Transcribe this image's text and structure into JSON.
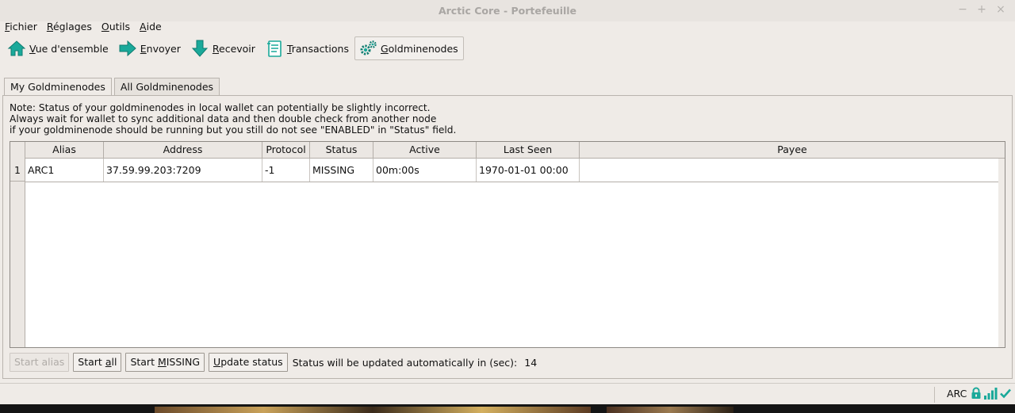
{
  "window": {
    "title": "Arctic Core - Portefeuille",
    "controls": {
      "minimize": "−",
      "maximize": "+",
      "close": "×"
    }
  },
  "menu": [
    {
      "label": "Fichier",
      "mnemonic_index": 0
    },
    {
      "label": "Réglages",
      "mnemonic_index": 0
    },
    {
      "label": "Outils",
      "mnemonic_index": 0
    },
    {
      "label": "Aide",
      "mnemonic_index": 0
    }
  ],
  "toolbar": {
    "overview": "Vue d'ensemble",
    "send": "Envoyer",
    "receive": "Recevoir",
    "transactions": "Transactions",
    "goldminenodes": "Goldminenodes",
    "accent": "#1aa99a"
  },
  "tabs": {
    "my": "My Goldminenodes",
    "all": "All Goldminenodes"
  },
  "note": {
    "line1": "Note: Status of your goldminenodes in local wallet can potentially be slightly incorrect.",
    "line2": "Always wait for wallet to sync additional data and then double check from another node",
    "line3": "if your goldminenode should be running but you still do not see \"ENABLED\" in \"Status\" field."
  },
  "table": {
    "headers": {
      "alias": "Alias",
      "address": "Address",
      "protocol": "Protocol",
      "status": "Status",
      "active": "Active",
      "last_seen": "Last Seen",
      "payee": "Payee"
    },
    "rows": [
      {
        "num": "1",
        "alias": "ARC1",
        "address": "37.59.99.203:7209",
        "protocol": "-1",
        "status": "MISSING",
        "active": "00m:00s",
        "last_seen": "1970-01-01 00:00",
        "payee": ""
      }
    ]
  },
  "buttons": {
    "start_alias": "Start alias",
    "start_all": "Start all",
    "start_missing": "Start MISSING",
    "update_status": "Update status"
  },
  "auto_update": {
    "label": "Status will be updated automatically in (sec):",
    "seconds": "14"
  },
  "statusbar": {
    "unit": "ARC",
    "icons": [
      "lock-icon",
      "signal-bars-icon",
      "synced-check-icon"
    ]
  }
}
